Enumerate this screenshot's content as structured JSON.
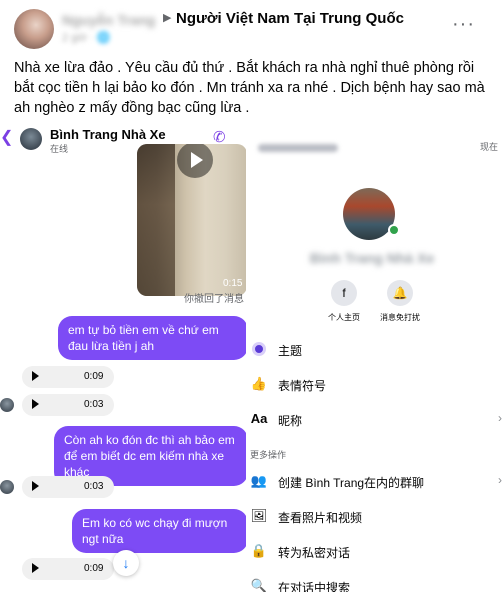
{
  "post": {
    "author_name": "Nguyễn Trang",
    "group_name": "Người Việt Nam Tại Trung Quốc",
    "meta": "2 giờ · 🌐",
    "text": "Nhà xe lừa đảo . Yêu cầu đủ thứ . Bắt khách ra nhà nghỉ thuê phòng rồi bắt cọc tiền h lại bảo ko đón . Mn tránh xa ra nhé . Dịch bệnh hay sao mà ah nghèo z mấy đồng bạc cũng lừa .",
    "more_glyph": "···",
    "arrow_glyph": "▶"
  },
  "chat": {
    "title": "Bình Trang Nhà Xe",
    "status": "在线",
    "video_duration": "0:15",
    "recall_note": "你撤回了消息",
    "messages": [
      {
        "type": "out",
        "text": "em tự bỏ tiền em về chứ em đau lừa tiền j ah"
      },
      {
        "type": "audio",
        "duration": "0:09"
      },
      {
        "type": "audio",
        "duration": "0:03"
      },
      {
        "type": "out",
        "text": "Còn ah ko đón đc thì ah bảo em để em biết dc em kiếm nhà xe khác"
      },
      {
        "type": "audio",
        "duration": "0:03"
      },
      {
        "type": "out",
        "text": "Em ko có wc chạy đi mượn ngt nữa"
      },
      {
        "type": "audio",
        "duration": "0:09"
      }
    ]
  },
  "info": {
    "now_label": "现在",
    "name": "Bình Trang Nhà Xe",
    "actions": [
      {
        "label": "个人主页",
        "icon": "facebook-icon"
      },
      {
        "label": "消息免打扰",
        "icon": "bell-icon"
      }
    ],
    "menu": [
      {
        "label": "主题",
        "icon": "theme-icon"
      },
      {
        "label": "表情符号",
        "icon": "like-icon"
      },
      {
        "label": "昵称",
        "icon": "nickname-icon"
      }
    ],
    "section_label": "更多操作",
    "more_menu": [
      {
        "label": "创建 Bình Trang在内的群聊",
        "icon": "group-icon"
      },
      {
        "label": "查看照片和视频",
        "icon": "photo-icon"
      },
      {
        "label": "转为私密对话",
        "icon": "lock-icon"
      },
      {
        "label": "在对话中搜索",
        "icon": "search-icon"
      }
    ]
  }
}
